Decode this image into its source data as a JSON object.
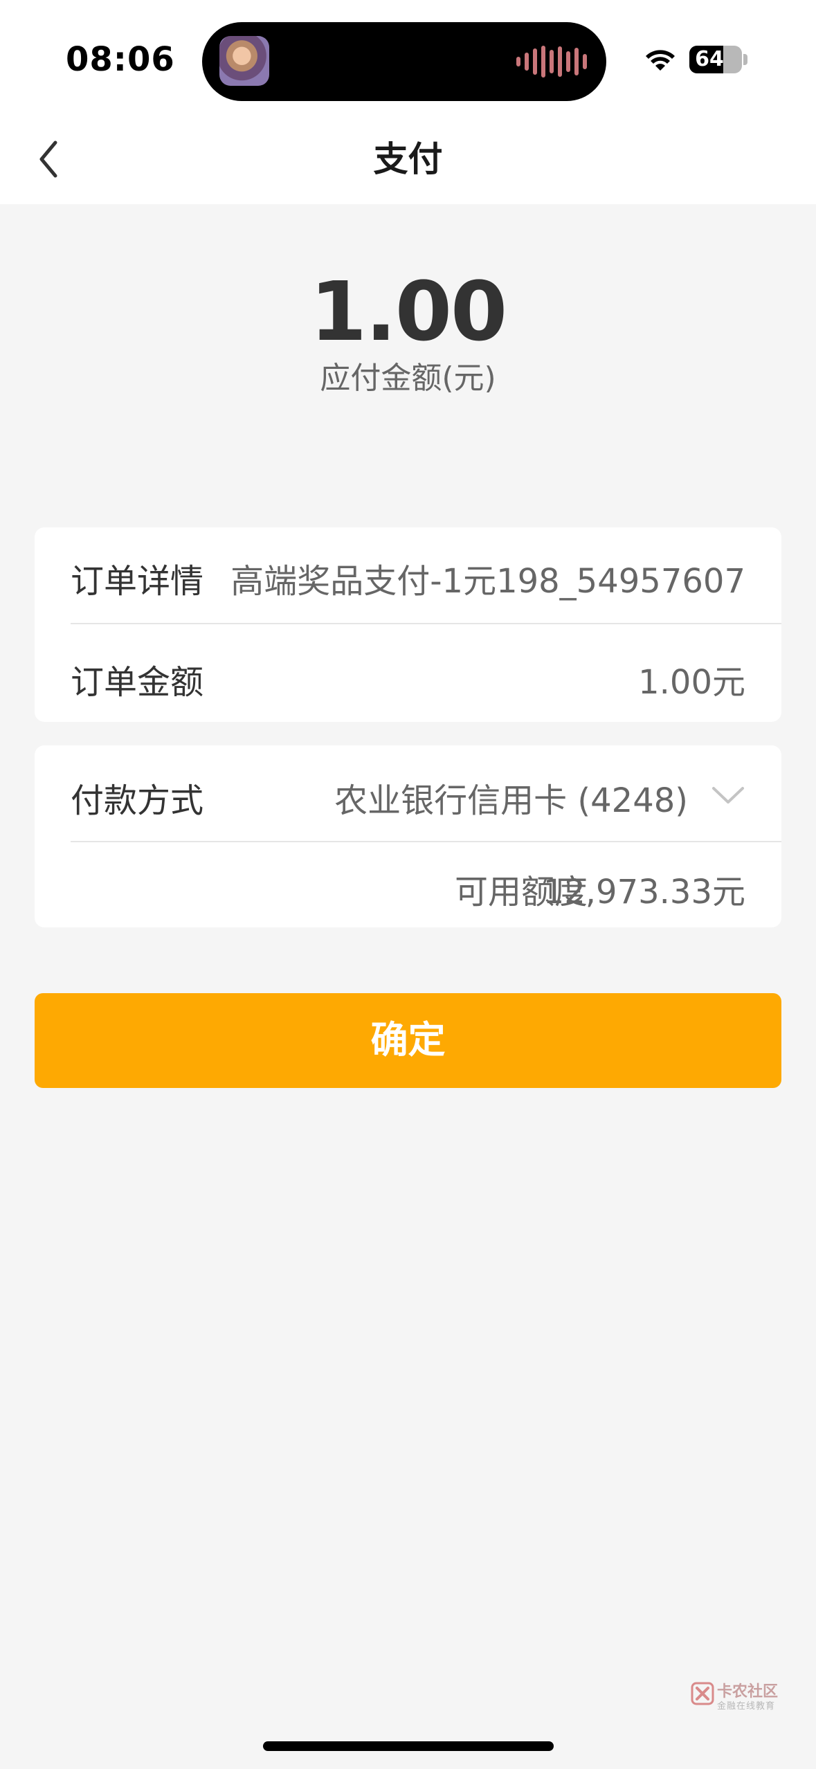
{
  "status_bar": {
    "time": "08:06",
    "battery_level": "64",
    "battery_fraction": 0.64,
    "icons": [
      "wifi-icon",
      "battery-icon"
    ]
  },
  "nav": {
    "title": "支付",
    "back_icon": "chevron-left-icon"
  },
  "amount": {
    "value": "1.00",
    "label": "应付金额(元)"
  },
  "order": {
    "detail_label": "订单详情",
    "detail_value": "高端奖品支付-1元198_54957607",
    "amount_label": "订单金额",
    "amount_value": "1.00元"
  },
  "payment": {
    "method_label": "付款方式",
    "method_value": "农业银行信用卡 (4248)",
    "dropdown_icon": "chevron-down-icon",
    "credit_label": "可用额度",
    "credit_value": "12,973.33元"
  },
  "confirm": {
    "label": "确定",
    "color": "#fea902"
  },
  "watermark": {
    "title": "卡农社区",
    "subtitle": "金融在线教育"
  },
  "colors": {
    "accent": "#fea902",
    "background": "#f5f5f5"
  }
}
